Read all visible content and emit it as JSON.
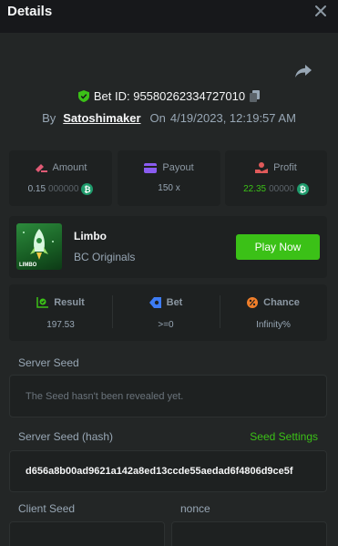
{
  "header": {
    "title": "Details"
  },
  "bet": {
    "id_label": "Bet ID: 95580262334727010",
    "by_label": "By",
    "username": "Satoshimaker",
    "on_label": "On",
    "datetime": "4/19/2023, 12:19:57 AM"
  },
  "stats": {
    "amount": {
      "label": "Amount",
      "value_main": "0.15",
      "value_dim": "000000"
    },
    "payout": {
      "label": "Payout",
      "value": "150 x"
    },
    "profit": {
      "label": "Profit",
      "value_main": "22.35",
      "value_dim": "00000"
    }
  },
  "game": {
    "thumb_text": "LIMBO",
    "name": "Limbo",
    "provider": "BC Originals",
    "play_label": "Play Now"
  },
  "result": {
    "result": {
      "label": "Result",
      "value": "197.53"
    },
    "bet": {
      "label": "Bet",
      "value": ">=0"
    },
    "chance": {
      "label": "Chance",
      "value": "Infinity%"
    }
  },
  "seeds": {
    "server_seed_label": "Server Seed",
    "server_seed_value": "The Seed hasn't been revealed yet.",
    "server_hash_label": "Server Seed (hash)",
    "seed_settings_label": "Seed Settings",
    "server_hash_value": "d656a8b00ad9621a142a8ed13ccde55aedad6f4806d9ce5f",
    "client_seed_label": "Client Seed",
    "nonce_label": "nonce"
  },
  "colors": {
    "accent": "#3bc117",
    "background": "#232626",
    "panel": "#1e2121",
    "header": "#17181b"
  },
  "icons": [
    "close-icon",
    "share-icon",
    "shield-check-icon",
    "copy-icon",
    "coin-icon",
    "amount-icon",
    "payout-icon",
    "profit-icon",
    "result-icon",
    "bet-icon",
    "chance-icon"
  ]
}
